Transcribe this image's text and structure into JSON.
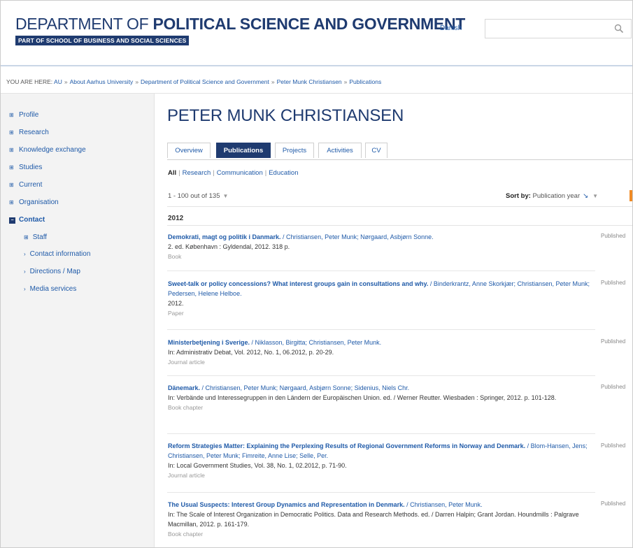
{
  "header": {
    "title_prefix": "DEPARTMENT OF ",
    "title_bold": "POLITICAL SCIENCE AND GOVERNMENT",
    "part_of": "PART OF SCHOOL OF BUSINESS AND SOCIAL SCIENCES",
    "language_link": "Danish",
    "search_placeholder": "",
    "search_icon": "search-icon"
  },
  "breadcrumb": {
    "prefix": "YOU ARE HERE:",
    "items": [
      "AU",
      "About Aarhus University",
      "Department of Political Science and Government",
      "Peter Munk Christiansen",
      "Publications"
    ],
    "separator": "»"
  },
  "sidebar": {
    "items": [
      {
        "label": "Profile",
        "marker": "⊞"
      },
      {
        "label": "Research",
        "marker": "⊞"
      },
      {
        "label": "Knowledge exchange",
        "marker": "⊞"
      },
      {
        "label": "Studies",
        "marker": "⊞"
      },
      {
        "label": "Current",
        "marker": "⊞"
      },
      {
        "label": "Organisation",
        "marker": "⊞"
      },
      {
        "label": "Contact",
        "marker": "−"
      }
    ],
    "subitems": [
      {
        "label": "Staff",
        "marker": "⊞"
      },
      {
        "label": "Contact information",
        "marker": "›"
      },
      {
        "label": "Directions / Map",
        "marker": "›"
      },
      {
        "label": "Media services",
        "marker": "›"
      }
    ]
  },
  "main": {
    "title": "PETER MUNK CHRISTIANSEN",
    "tabs": [
      "Overview",
      "Publications",
      "Projects",
      "Activities",
      "CV"
    ],
    "active_tab": "Publications",
    "filters": [
      "All",
      "Research",
      "Communication",
      "Education"
    ],
    "filter_separator": "|",
    "count_text": "1 - 100 out of 135",
    "count_chevron": "▼",
    "sort_label": "Sort by:",
    "sort_value": "Publication year",
    "sort_arrow": "↘",
    "sort_chevron": "▼",
    "accent_color": "#1f3b70",
    "link_color": "#1f5aa8",
    "year": "2012",
    "status_label": "Published",
    "publications": [
      {
        "title": "Demokrati, magt og politik i Danmark.",
        "authors": " / Christiansen, Peter Munk; Nørgaard, Asbjørn Sonne.",
        "details": "2. ed. København : Gyldendal, 2012. 318 p.",
        "type": "Book"
      },
      {
        "title": "Sweet-talk or policy concessions? What interest groups gain in consultations and why.",
        "authors": " / Binderkrantz, Anne Skorkjær; Christiansen, Peter Munk; Pedersen, Helene Helboe.",
        "details": "2012.",
        "type": "Paper"
      },
      {
        "title": "Ministerbetjening i Sverige.",
        "authors": " / Niklasson, Birgitta; Christiansen, Peter Munk.",
        "details": "In: Administrativ Debat, Vol. 2012, No. 1, 06.2012, p. 20-29.",
        "type": "Journal article"
      },
      {
        "title": "Dänemark.",
        "authors": " / Christiansen, Peter Munk; Nørgaard, Asbjørn Sonne; Sidenius, Niels Chr.",
        "details": "In: Verbände und Interessegruppen in den Ländern der Europäischen Union. ed. / Werner Reutter. Wiesbaden : Springer, 2012. p. 101-128.",
        "type": "Book chapter"
      },
      {
        "title": "Reform Strategies Matter: Explaining the Perplexing Results of Regional Government Reforms in Norway and Denmark.",
        "authors": " / Blom-Hansen, Jens; Christiansen, Peter Munk; Fimreite, Anne Lise; Selle, Per.",
        "details": "In: Local Government Studies, Vol. 38, No. 1, 02.2012, p. 71-90.",
        "type": "Journal article"
      },
      {
        "title": "The Usual Suspects: Interest Group Dynamics and Representation in Denmark.",
        "authors": " / Christiansen, Peter Munk.",
        "details": "In: The Scale of Interest Organization in Democratic Politics. Data and Research Methods. ed. / Darren Halpin; Grant Jordan. Houndmills : Palgrave Macmillan, 2012. p. 161-179.",
        "type": "Book chapter"
      }
    ]
  }
}
